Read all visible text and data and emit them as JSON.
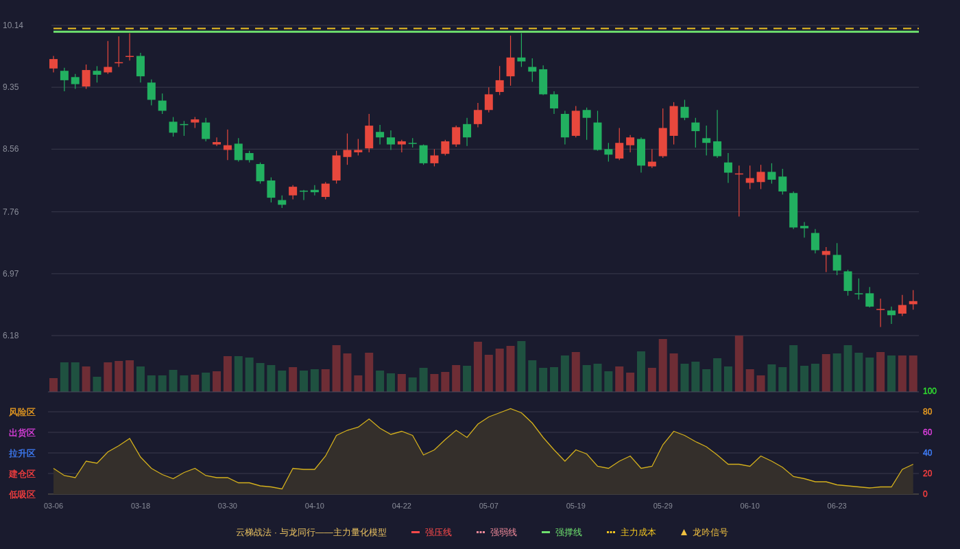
{
  "price_chart": {
    "chart_data": {
      "type": "candlestick",
      "grid": true,
      "ylim": [
        6.18,
        10.14
      ],
      "yticks": [
        {
          "value": 10.14,
          "label": "10.14"
        },
        {
          "value": 9.35,
          "label": "9.35"
        },
        {
          "value": 8.56,
          "label": "8.56"
        },
        {
          "value": 7.76,
          "label": "7.76"
        },
        {
          "value": 6.97,
          "label": "6.97"
        },
        {
          "value": 6.18,
          "label": "6.18"
        }
      ],
      "ohlc": [
        [
          9.59,
          9.75,
          9.54,
          9.71
        ],
        [
          9.56,
          9.6,
          9.3,
          9.44
        ],
        [
          9.48,
          9.52,
          9.33,
          9.39
        ],
        [
          9.36,
          9.64,
          9.33,
          9.57
        ],
        [
          9.56,
          9.62,
          9.41,
          9.51
        ],
        [
          9.54,
          9.94,
          9.52,
          9.61
        ],
        [
          9.66,
          10.0,
          9.61,
          9.67
        ],
        [
          9.74,
          10.04,
          9.69,
          9.75
        ],
        [
          9.75,
          9.79,
          9.41,
          9.49
        ],
        [
          9.41,
          9.45,
          9.12,
          9.19
        ],
        [
          9.18,
          9.27,
          9.01,
          9.05
        ],
        [
          8.91,
          8.97,
          8.72,
          8.77
        ],
        [
          8.88,
          8.92,
          8.73,
          8.87
        ],
        [
          8.9,
          8.97,
          8.83,
          8.94
        ],
        [
          8.9,
          8.96,
          8.66,
          8.69
        ],
        [
          8.62,
          8.71,
          8.6,
          8.65
        ],
        [
          8.55,
          8.81,
          8.42,
          8.61
        ],
        [
          8.63,
          8.7,
          8.4,
          8.42
        ],
        [
          8.51,
          8.54,
          8.39,
          8.42
        ],
        [
          8.37,
          8.39,
          8.12,
          8.15
        ],
        [
          8.16,
          8.2,
          7.88,
          7.94
        ],
        [
          7.91,
          7.97,
          7.81,
          7.85
        ],
        [
          7.97,
          8.1,
          7.92,
          8.08
        ],
        [
          8.03,
          8.04,
          7.91,
          8.02
        ],
        [
          8.04,
          8.1,
          7.97,
          8.01
        ],
        [
          7.95,
          8.14,
          7.92,
          8.12
        ],
        [
          8.16,
          8.54,
          8.12,
          8.48
        ],
        [
          8.46,
          8.76,
          8.36,
          8.55
        ],
        [
          8.52,
          8.69,
          8.48,
          8.55
        ],
        [
          8.57,
          9.01,
          8.52,
          8.86
        ],
        [
          8.78,
          8.87,
          8.62,
          8.71
        ],
        [
          8.71,
          8.8,
          8.55,
          8.62
        ],
        [
          8.62,
          8.68,
          8.52,
          8.66
        ],
        [
          8.64,
          8.7,
          8.58,
          8.63
        ],
        [
          8.61,
          8.62,
          8.36,
          8.38
        ],
        [
          8.38,
          8.56,
          8.34,
          8.48
        ],
        [
          8.5,
          8.68,
          8.48,
          8.66
        ],
        [
          8.62,
          8.86,
          8.59,
          8.84
        ],
        [
          8.88,
          8.96,
          8.6,
          8.71
        ],
        [
          8.88,
          9.15,
          8.84,
          9.06
        ],
        [
          9.06,
          9.35,
          9.03,
          9.26
        ],
        [
          9.29,
          9.62,
          9.25,
          9.44
        ],
        [
          9.49,
          10.01,
          9.37,
          9.73
        ],
        [
          9.73,
          10.04,
          9.61,
          9.68
        ],
        [
          9.61,
          9.72,
          9.42,
          9.55
        ],
        [
          9.58,
          9.63,
          9.25,
          9.26
        ],
        [
          9.26,
          9.3,
          9.01,
          9.08
        ],
        [
          9.01,
          9.05,
          8.62,
          8.71
        ],
        [
          8.73,
          9.11,
          8.71,
          9.05
        ],
        [
          9.06,
          9.09,
          8.68,
          8.96
        ],
        [
          8.9,
          9.05,
          8.54,
          8.55
        ],
        [
          8.56,
          8.64,
          8.4,
          8.49
        ],
        [
          8.44,
          8.83,
          8.42,
          8.64
        ],
        [
          8.61,
          8.74,
          8.52,
          8.71
        ],
        [
          8.69,
          8.71,
          8.26,
          8.35
        ],
        [
          8.34,
          8.56,
          8.32,
          8.4
        ],
        [
          8.47,
          9.08,
          8.45,
          8.83
        ],
        [
          8.73,
          9.16,
          8.62,
          9.11
        ],
        [
          9.1,
          9.19,
          8.93,
          8.96
        ],
        [
          8.9,
          8.96,
          8.58,
          8.79
        ],
        [
          8.7,
          8.86,
          8.48,
          8.64
        ],
        [
          8.66,
          9.06,
          8.45,
          8.47
        ],
        [
          8.39,
          8.51,
          8.13,
          8.26
        ],
        [
          8.24,
          8.35,
          7.7,
          8.25
        ],
        [
          8.13,
          8.35,
          8.05,
          8.19
        ],
        [
          8.14,
          8.36,
          8.05,
          8.27
        ],
        [
          8.27,
          8.38,
          8.12,
          8.17
        ],
        [
          8.21,
          8.31,
          7.98,
          8.02
        ],
        [
          8.0,
          8.02,
          7.54,
          7.56
        ],
        [
          7.58,
          7.63,
          7.43,
          7.55
        ],
        [
          7.49,
          7.54,
          7.23,
          7.27
        ],
        [
          7.21,
          7.31,
          6.99,
          7.26
        ],
        [
          7.21,
          7.36,
          6.95,
          7.01
        ],
        [
          7.0,
          7.02,
          6.69,
          6.75
        ],
        [
          6.72,
          6.91,
          6.64,
          6.71
        ],
        [
          6.72,
          6.8,
          6.54,
          6.55
        ],
        [
          6.51,
          6.65,
          6.29,
          6.52
        ],
        [
          6.5,
          6.55,
          6.33,
          6.44
        ],
        [
          6.46,
          6.7,
          6.43,
          6.57
        ],
        [
          6.58,
          6.76,
          6.51,
          6.62
        ]
      ],
      "ref_lines": [
        {
          "axis": "y",
          "value": 10.1
        },
        {
          "axis": "y",
          "value": 10.06
        }
      ]
    }
  },
  "indicator": {
    "zones": [
      {
        "label": "风险区",
        "color": "#f0a020"
      },
      {
        "label": "出货区",
        "color": "#e040e0"
      },
      {
        "label": "拉升区",
        "color": "#4080ff"
      },
      {
        "label": "建仓区",
        "color": "#ff4040"
      },
      {
        "label": "低吸区",
        "color": "#ff4040"
      }
    ],
    "tick_colors": [
      {
        "color": "#30e030"
      },
      {
        "color": "#f0a020"
      },
      {
        "color": "#e040e0"
      },
      {
        "color": "#4080ff"
      },
      {
        "color": "#ff4040"
      },
      {
        "color": "#ff4040"
      }
    ],
    "dates": [
      "03-06",
      "03-18",
      "03-30",
      "04-10",
      "04-22",
      "05-07",
      "05-19",
      "05-29",
      "06-10",
      "06-23"
    ],
    "chart_data": {
      "type": "area",
      "grid": true,
      "ylim": [
        0,
        100
      ],
      "yticks": [
        {
          "value": 100,
          "label": "100"
        },
        {
          "value": 80,
          "label": "80"
        },
        {
          "value": 60,
          "label": "60"
        },
        {
          "value": 40,
          "label": "40"
        },
        {
          "value": 20,
          "label": "20"
        },
        {
          "value": 0,
          "label": "0"
        }
      ],
      "series": [
        {
          "color": "#d4b01c",
          "values": [
            25,
            18,
            16,
            32,
            30,
            41,
            47,
            54,
            36,
            25,
            19,
            15,
            21,
            25,
            18,
            16,
            16,
            11,
            11,
            8,
            7,
            5,
            25,
            24,
            24,
            37,
            57,
            62,
            65,
            73,
            64,
            58,
            61,
            57,
            38,
            43,
            53,
            62,
            55,
            68,
            75,
            79,
            83,
            79,
            69,
            55,
            43,
            32,
            43,
            39,
            27,
            25,
            32,
            37,
            25,
            27,
            48,
            61,
            57,
            51,
            46,
            38,
            29,
            29,
            27,
            37,
            32,
            26,
            17,
            15,
            12,
            12,
            9,
            8,
            7,
            6,
            7,
            7,
            24,
            29
          ]
        }
      ]
    }
  },
  "legend": {
    "title": "云梯战法 · 与龙同行——主力量化模型",
    "items": [
      {
        "label": "强压线",
        "kind": "solid",
        "color": "#ff4a4a"
      },
      {
        "label": "强弱线",
        "kind": "dashed",
        "color": "#f08a9a"
      },
      {
        "label": "强撑线",
        "kind": "solid",
        "color": "#6ee06e"
      },
      {
        "label": "主力成本",
        "kind": "dashed",
        "color": "#f0c420"
      },
      {
        "label": "龙吟信号",
        "kind": "triangle",
        "color": "#f0c040"
      }
    ]
  }
}
